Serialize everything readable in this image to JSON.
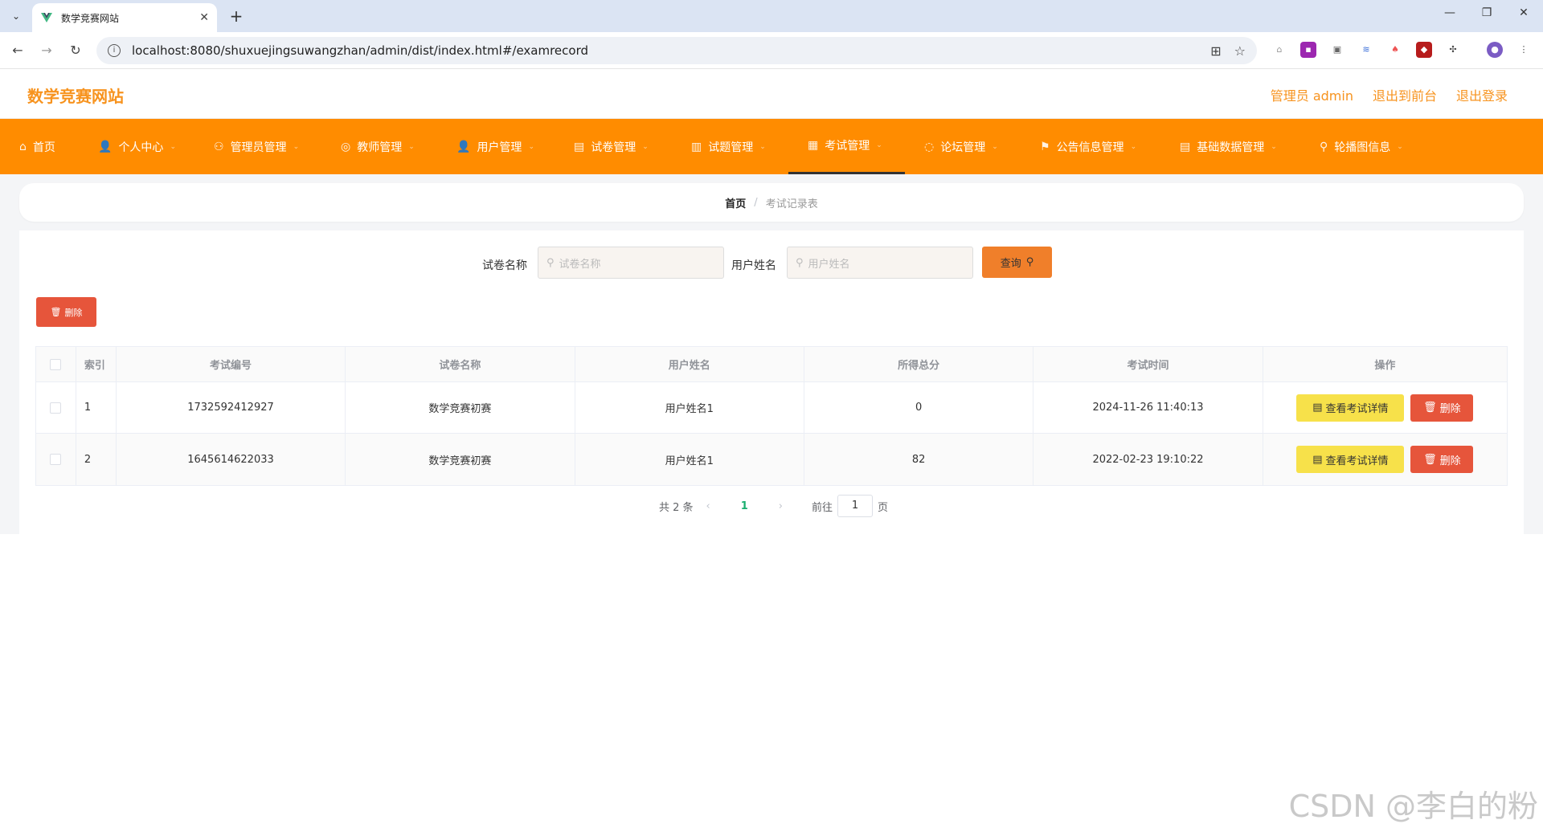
{
  "browser": {
    "tab_title": "数学竞赛网站",
    "url": "localhost:8080/shuxuejingsuwangzhan/admin/dist/index.html#/examrecord"
  },
  "header": {
    "site_title": "数学竞赛网站",
    "admin_label": "管理员 admin",
    "to_front_label": "退出到前台",
    "logout_label": "退出登录"
  },
  "nav": {
    "items": [
      {
        "label": "首页"
      },
      {
        "label": "个人中心"
      },
      {
        "label": "管理员管理"
      },
      {
        "label": "教师管理"
      },
      {
        "label": "用户管理"
      },
      {
        "label": "试卷管理"
      },
      {
        "label": "试题管理"
      },
      {
        "label": "考试管理"
      },
      {
        "label": "论坛管理"
      },
      {
        "label": "公告信息管理"
      },
      {
        "label": "基础数据管理"
      },
      {
        "label": "轮播图信息"
      }
    ],
    "active": "考试管理",
    "accent_color": "#ff8c00"
  },
  "breadcrumb": {
    "home": "首页",
    "separator": "/",
    "current": "考试记录表"
  },
  "search": {
    "paper_label": "试卷名称",
    "paper_placeholder": "试卷名称",
    "user_label": "用户姓名",
    "user_placeholder": "用户姓名",
    "query_label": "查询"
  },
  "toolbar": {
    "delete_label": "删除"
  },
  "table": {
    "headers": [
      "索引",
      "考试编号",
      "试卷名称",
      "用户姓名",
      "所得总分",
      "考试时间",
      "操作"
    ],
    "rows": [
      {
        "index": "1",
        "exam_no": "1732592412927",
        "paper": "数学竞赛初赛",
        "user": "用户姓名1",
        "score": "0",
        "time": "2024-11-26 11:40:13"
      },
      {
        "index": "2",
        "exam_no": "1645614622033",
        "paper": "数学竞赛初赛",
        "user": "用户姓名1",
        "score": "82",
        "time": "2022-02-23 19:10:22"
      }
    ],
    "detail_label": "查看考试详情",
    "delete_label": "删除"
  },
  "pagination": {
    "total": "共 2 条",
    "current_page": "1",
    "goto_label": "前往",
    "goto_value": "1",
    "page_suffix": "页"
  },
  "watermark": "CSDN @李白的粉"
}
